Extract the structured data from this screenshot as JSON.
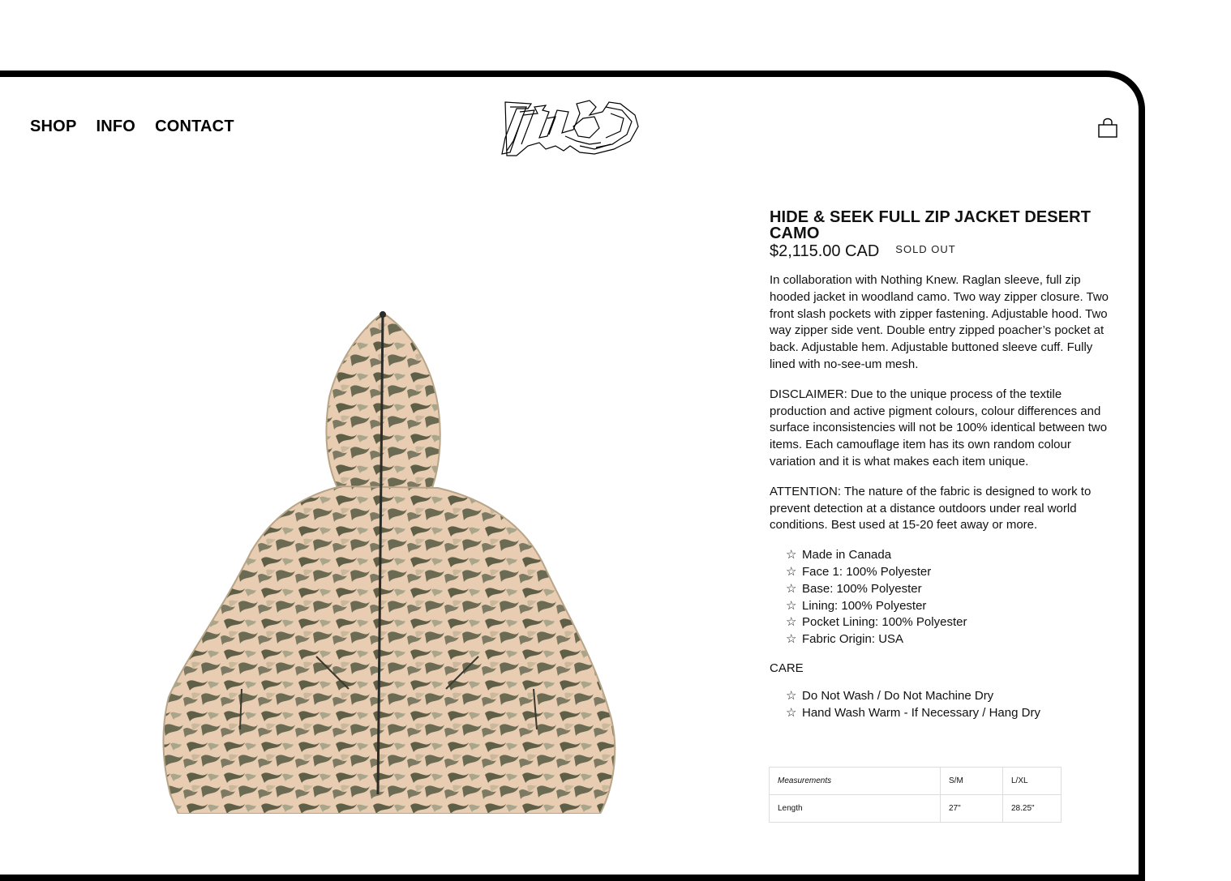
{
  "nav": {
    "items": [
      {
        "label": "SHOP"
      },
      {
        "label": "INFO"
      },
      {
        "label": "CONTACT"
      }
    ]
  },
  "brand": {
    "logo_text": "TNED"
  },
  "product": {
    "title": "HIDE & SEEK FULL ZIP JACKET DESERT CAMO",
    "price": "$2,115.00 CAD",
    "status": "SOLD OUT",
    "description": "In collaboration with Nothing Knew. Raglan sleeve, full zip hooded jacket in woodland camo. Two way zipper closure. Two front slash pockets with zipper fastening. Adjustable hood. Two way zipper side vent. Double entry zipped poacher’s pocket at back. Adjustable hem. Adjustable buttoned sleeve cuff. Fully lined with no-see-um mesh.",
    "disclaimer": "DISCLAIMER: Due to the unique process of the textile production and active pigment colours, colour differences and surface inconsistencies will not be 100% identical between two items. Each camouflage item has its own random colour variation and it is what makes each item unique.",
    "attention": "ATTENTION: The nature of the fabric is designed to work to prevent detection at a distance outdoors under real world conditions. Best used at 15-20 feet away or more.",
    "specs": [
      "Made in Canada",
      "Face 1: 100% Polyester",
      "Base: 100% Polyester",
      "Lining: 100% Polyester",
      "Pocket Lining: 100% Polyester",
      "Fabric Origin: USA"
    ],
    "care_label": "CARE",
    "care": [
      "Do Not Wash / Do Not Machine Dry",
      "Hand Wash Warm - If Necessary / Hang Dry"
    ],
    "bullet_icon": "star-outline-icon"
  },
  "measurements": {
    "headers": [
      "Measurements",
      "S/M",
      "L/XL"
    ],
    "rows": [
      [
        "Length",
        "27\"",
        "28.25\""
      ]
    ]
  },
  "colors": {
    "frame": "#000000",
    "text": "#111111",
    "camo_base": "#e7c9ad",
    "camo_dark": "#5d5b45"
  }
}
